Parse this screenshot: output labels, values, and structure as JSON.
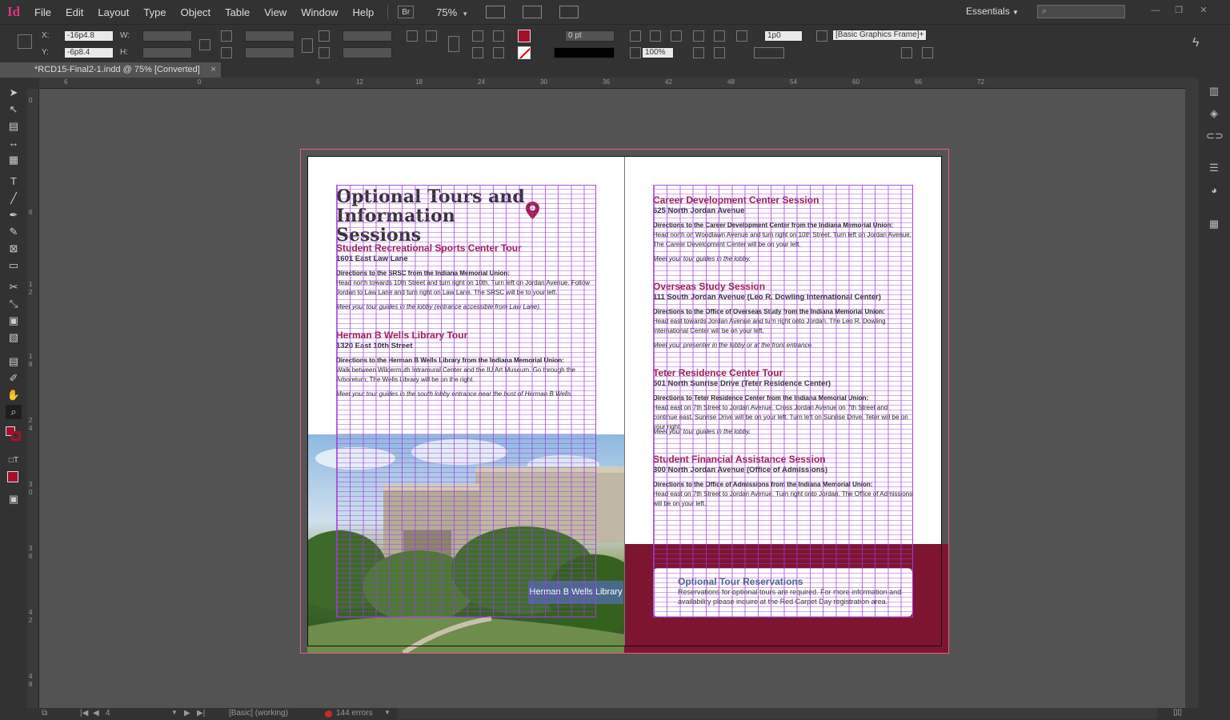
{
  "app": {
    "logo": "Id"
  },
  "menu": [
    "File",
    "Edit",
    "Layout",
    "Type",
    "Object",
    "Table",
    "View",
    "Window",
    "Help"
  ],
  "bridge_label": "Br",
  "zoom": "75%",
  "workspace": "Essentials",
  "search_placeholder": "",
  "control": {
    "x_label": "X:",
    "x_value": "-16p4.8",
    "y_label": "Y:",
    "y_value": "-6p8.4",
    "w_label": "W:",
    "h_label": "H:",
    "stroke_weight": "0 pt",
    "opacity": "100%",
    "offset": "1p0",
    "object_style": "[Basic Graphics Frame]+"
  },
  "tab": {
    "title": "*RCD15-Final2-1.indd @ 75% [Converted]",
    "close": "×"
  },
  "ruler_marks": [
    "6",
    "0",
    "6",
    "12",
    "18",
    "24",
    "30",
    "36",
    "42",
    "48",
    "54",
    "60",
    "66",
    "72"
  ],
  "ruler_v_marks": [
    "0",
    "6",
    "1",
    "2",
    "1",
    "8",
    "2",
    "4",
    "3",
    "0",
    "3",
    "6",
    "4",
    "2",
    "4",
    "8"
  ],
  "status": {
    "page": "4",
    "style": "[Basic] (working)",
    "errors": "144 errors"
  },
  "colors": {
    "accent_red": "#a3102c",
    "brand_maroon": "#7d1530",
    "heading_red": "#a01e4a",
    "caption_blue": "#4a6a8c"
  },
  "doc": {
    "title_line1": "Optional Tours and",
    "title_line2": "Information Sessions",
    "left": [
      {
        "title": "Student Recreational Sports Center Tour",
        "address": "1601 East Law Lane",
        "dir_head": "Directions to the SRSC from the Indiana Memorial Union:",
        "dir_body": "Head north towards 10th Street and turn right on 10th. Turn left on Jordan Avenue. Follow Jordan to Law Lane and turn right on Law Lane. The SRSC will be to your left.",
        "meet": "Meet your tour guides in the lobby (entrance accessible from Law Lane)."
      },
      {
        "title": "Herman B Wells Library Tour",
        "address": "1320 East 10th Street",
        "dir_head": "Directions to the Herman B Wells Library from the Indiana Memorial Union:",
        "dir_body": "Walk between Wildermuth Intramural Center and the IU Art Museum. Go through the Arboretum; The Wells Library will be on the right.",
        "meet": "Meet your tour guides in the south lobby entrance near the bust of Herman B Wells."
      }
    ],
    "right": [
      {
        "title": "Career Development Center Session",
        "address": "625 North Jordan Avenue",
        "dir_head": "Directions to the Career Development Center from the Indiana Memorial Union:",
        "dir_body": "Head north on Woodlawn Avenue and turn right on 10th Street. Turn left on Jordan Avenue. The Career Development Center will be on your left.",
        "meet": "Meet your tour guides in the lobby."
      },
      {
        "title": "Overseas Study Session",
        "address": "111 South Jordan Avenue (Leo R. Dowling International Center)",
        "dir_head": "Directions to the Office of Overseas Study from the Indiana Memorial Union:",
        "dir_body": "Head east towards Jordan Avenue and turn right onto Jordan. The Leo R. Dowling International Center will be on your left.",
        "meet": "Meet your presenter in the lobby or at the front entrance."
      },
      {
        "title": "Teter Residence Center Tour",
        "address": "501 North Sunrise Drive (Teter Residence Center)",
        "dir_head": "Directions to Teter Residence Center from the Indiana Memorial Union:",
        "dir_body": "Head east on 7th Street to Jordan Avenue. Cross Jordan Avenue on 7th Street and continue east. Sunrise Drive will be on your left. Turn left on Sunrise Drive. Teter will be on your right.",
        "meet": "Meet your tour guides in the lobby."
      },
      {
        "title": "Student Financial Assistance Session",
        "address": "300 North Jordan Avenue (Office of Admissions)",
        "dir_head": "Directions to the Office of Admissions from the Indiana Memorial Union:",
        "dir_body": "Head east on 7th Street to Jordan Avenue. Turn right onto Jordan. The Office of Admissions will be on your left.",
        "meet": ""
      }
    ],
    "photo_caption": "Herman B Wells Library",
    "reservation_title": "Optional Tour Reservations",
    "reservation_body": "Reservations for optional tours are required. For more information and availability please inquire at the Red Carpet Day registration area."
  }
}
